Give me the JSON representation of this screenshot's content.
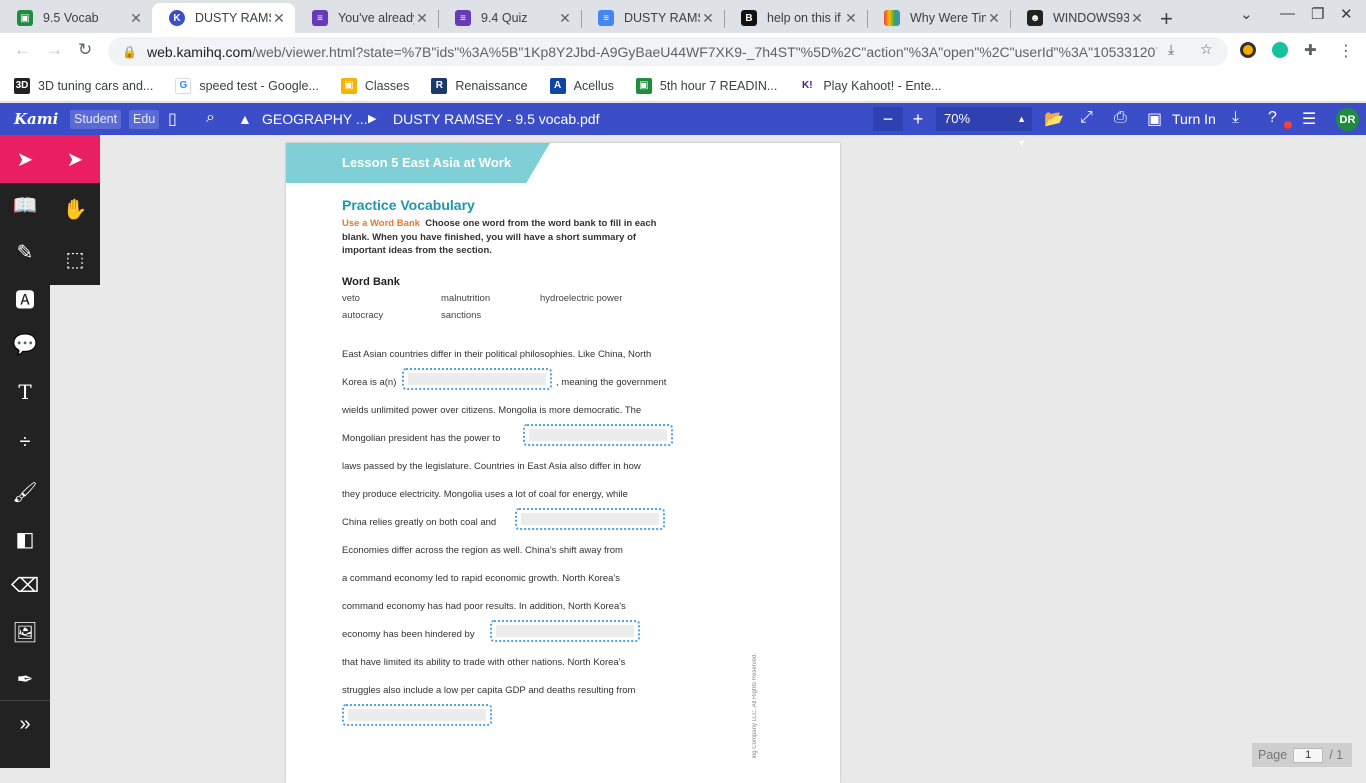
{
  "browser": {
    "tabs": [
      {
        "title": "9.5 Vocab",
        "icon": "google-classroom-icon",
        "color": "#1e8e3e"
      },
      {
        "title": "DUSTY RAMSE",
        "icon": "kami-icon",
        "color": "#3b4ec8"
      },
      {
        "title": "You've already",
        "icon": "google-forms-icon",
        "color": "#673ab7"
      },
      {
        "title": "9.4 Quiz",
        "icon": "google-forms-icon",
        "color": "#673ab7"
      },
      {
        "title": "DUSTY RAMSE",
        "icon": "google-docs-icon",
        "color": "#4285f4"
      },
      {
        "title": "help on this if",
        "icon": "brainly-icon",
        "color": "#111111"
      },
      {
        "title": "Why Were Tim",
        "icon": "colorful-icon",
        "color": "#ea4335"
      },
      {
        "title": "WINDOWS93",
        "icon": "windows93-icon",
        "color": "#222222"
      }
    ],
    "active_tab_index": 1,
    "url_host": "web.kamihq.com",
    "url_path": "/web/viewer.html?state=%7B\"ids\"%3A%5B\"1Kp8Y2Jbd-A9GyBaeU44WF7XK9-_7h4ST\"%5D%2C\"action\"%3A\"open\"%2C\"userId\"%3A\"10533120730...",
    "bookmarks": [
      {
        "label": "3D tuning cars and...",
        "icon": "3dt-icon",
        "color": "#222222"
      },
      {
        "label": "speed test - Google...",
        "icon": "google-icon",
        "color": "#4285f4"
      },
      {
        "label": "Classes",
        "icon": "classes-icon",
        "color": "#f4b400"
      },
      {
        "label": "Renaissance",
        "icon": "renaissance-icon",
        "color": "#1a3a6b"
      },
      {
        "label": "Acellus",
        "icon": "acellus-icon",
        "color": "#0d47a1"
      },
      {
        "label": "5th hour 7 READIN...",
        "icon": "classroom-icon",
        "color": "#1e8e3e"
      },
      {
        "label": "Play Kahoot! - Ente...",
        "icon": "kahoot-icon",
        "color": "#46178f"
      }
    ]
  },
  "kami": {
    "logo": "Kami",
    "badges": [
      "Student",
      "Edu"
    ],
    "folder": "GEOGRAPHY ...",
    "filename": "DUSTY RAMSEY - 9.5 vocab.pdf",
    "zoom": "70%",
    "turn_in": "Turn In",
    "avatar": "DR",
    "page_label": "Page",
    "page_current": "1",
    "page_total": "/ 1"
  },
  "document": {
    "lesson_header": "Lesson 5  East Asia at Work",
    "title": "Practice Vocabulary",
    "instruction_lead": "Use a Word Bank",
    "instruction_body": "Choose one word from the word bank to fill in each blank. When you have finished, you will have a short summary of important ideas from the section.",
    "word_bank_title": "Word Bank",
    "word_bank": [
      "veto",
      "malnutrition",
      "hydroelectric power",
      "autocracy",
      "sanctions"
    ],
    "lines": [
      "East Asian countries differ in their political philosophies. Like China, North",
      "Korea is a(n)",
      ", meaning the government",
      "wields unlimited power over citizens. Mongolia is more democratic. The",
      "Mongolian president has the power to",
      "laws passed by the legislature. Countries in East Asia also differ in how",
      "they produce electricity. Mongolia uses a lot of coal for energy, while",
      "China relies greatly on both coal and",
      "Economies differ across the region as well. China's shift away from",
      "a command economy led to rapid economic growth. North Korea's",
      "command economy has had poor results. In addition, North Korea's",
      "economy has been hindered by",
      "that have limited its ability to trade with other nations. North Korea's",
      "struggles also include a low per capita GDP and deaths resulting from"
    ],
    "copyright": "ing Company LLC. All Rights Reserved."
  }
}
